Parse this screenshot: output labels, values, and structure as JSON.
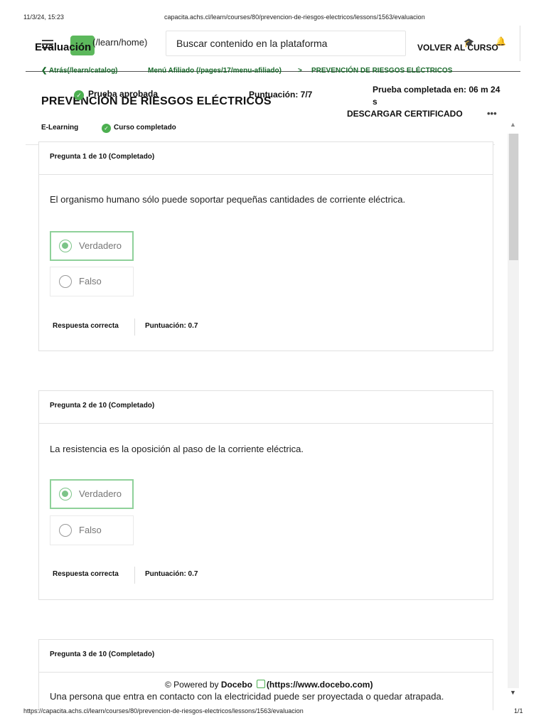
{
  "print": {
    "datetime": "11/3/24, 15:23",
    "url_top": "capacita.achs.cl/learn/courses/80/prevencion-de-riesgos-electricos/lessons/1563/evaluacion",
    "url_bottom": "https://capacita.achs.cl/learn/courses/80/prevencion-de-riesgos-electricos/lessons/1563/evaluacion",
    "page": "1/1"
  },
  "topbar": {
    "title": "Evaluación",
    "logo_link": "(/learn/home)",
    "search_placeholder": "Buscar contenido en la plataforma",
    "back_label": "VOLVER AL CURSO"
  },
  "breadcrumb": {
    "back": "Atrás(/learn/catalog)",
    "menu": "Menú Afiliado (/pages/17/menu-afiliado)",
    "separator": ">",
    "current": "PREVENCIÓN DE RIESGOS ELÉCTRICOS"
  },
  "course": {
    "title": "PREVENCIÓN DE RIESGOS ELÉCTRICOS",
    "status": "Prueba aprobada",
    "score": "Puntuación: 7/7",
    "completed_in": "Prueba completada en: 06 m 24 s",
    "download": "DESCARGAR CERTIFICADO",
    "more": "•••",
    "type": "E-Learning",
    "course_status": "Curso completado"
  },
  "questions": [
    {
      "header": "Pregunta 1 de 10  (Completado)",
      "text": "El organismo humano sólo puede soportar pequeñas cantidades de corriente eléctrica.",
      "options": [
        "Verdadero",
        "Falso"
      ],
      "selected": "Verdadero",
      "result": "Respuesta correcta",
      "score": "Puntuación: 0.7"
    },
    {
      "header": "Pregunta 2 de 10  (Completado)",
      "text": "La resistencia es la oposición al paso de la corriente eléctrica.",
      "options": [
        "Verdadero",
        "Falso"
      ],
      "selected": "Verdadero",
      "result": "Respuesta correcta",
      "score": "Puntuación: 0.7"
    },
    {
      "header": "Pregunta 3 de 10  (Completado)",
      "text": "Una persona que entra en contacto con la electricidad puede ser proyectada o quedar atrapada."
    }
  ],
  "footer": {
    "powered_prefix": "© Powered by",
    "brand": "Docebo",
    "link": "(https://www.docebo.com)"
  },
  "colors": {
    "accent": "#4caf50",
    "selected_border": "#8fd19a",
    "breadcrumb": "#1a6a2c"
  }
}
